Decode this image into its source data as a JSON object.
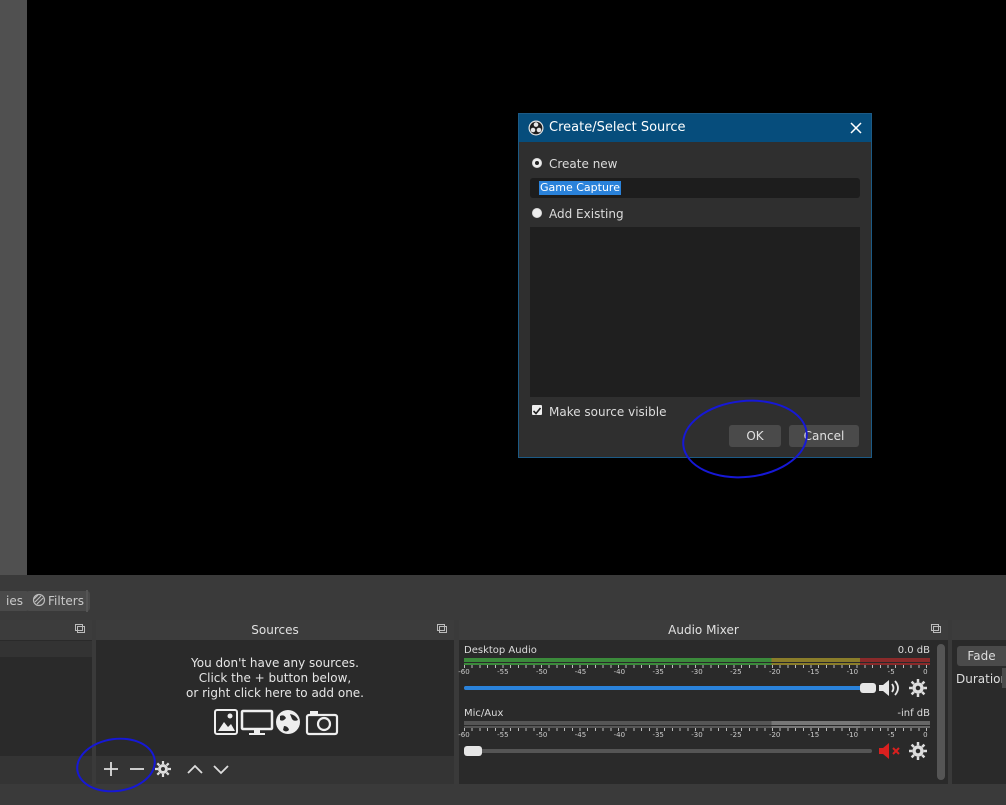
{
  "toolbar": {
    "properties_label": "ies",
    "filters_label": "Filters"
  },
  "sources": {
    "title": "Sources",
    "empty_line1": "You don't have any sources.",
    "empty_line2": "Click the + button below,",
    "empty_line3": "or right click here to add one."
  },
  "audio_mixer": {
    "title": "Audio Mixer",
    "channels": [
      {
        "name": "Desktop Audio",
        "level": "0.0 dB",
        "volume_percent": 100,
        "muted": false
      },
      {
        "name": "Mic/Aux",
        "level": "-inf dB",
        "volume_percent": 0,
        "muted": true
      }
    ],
    "ticks": [
      "-60",
      "-55",
      "-50",
      "-45",
      "-40",
      "-35",
      "-30",
      "-25",
      "-20",
      "-15",
      "-10",
      "-5",
      "0"
    ]
  },
  "transitions": {
    "fade_label": "Fade",
    "duration_label": "Duration"
  },
  "dialog": {
    "title": "Create/Select Source",
    "create_new_label": "Create new",
    "name_value": "Game Capture",
    "add_existing_label": "Add Existing",
    "make_visible_label": "Make source visible",
    "ok_label": "OK",
    "cancel_label": "Cancel"
  },
  "colors": {
    "accent": "#064d7c",
    "annotation": "#1618d6",
    "muted_red": "#d9201f",
    "volume_blue": "#2a82da"
  }
}
